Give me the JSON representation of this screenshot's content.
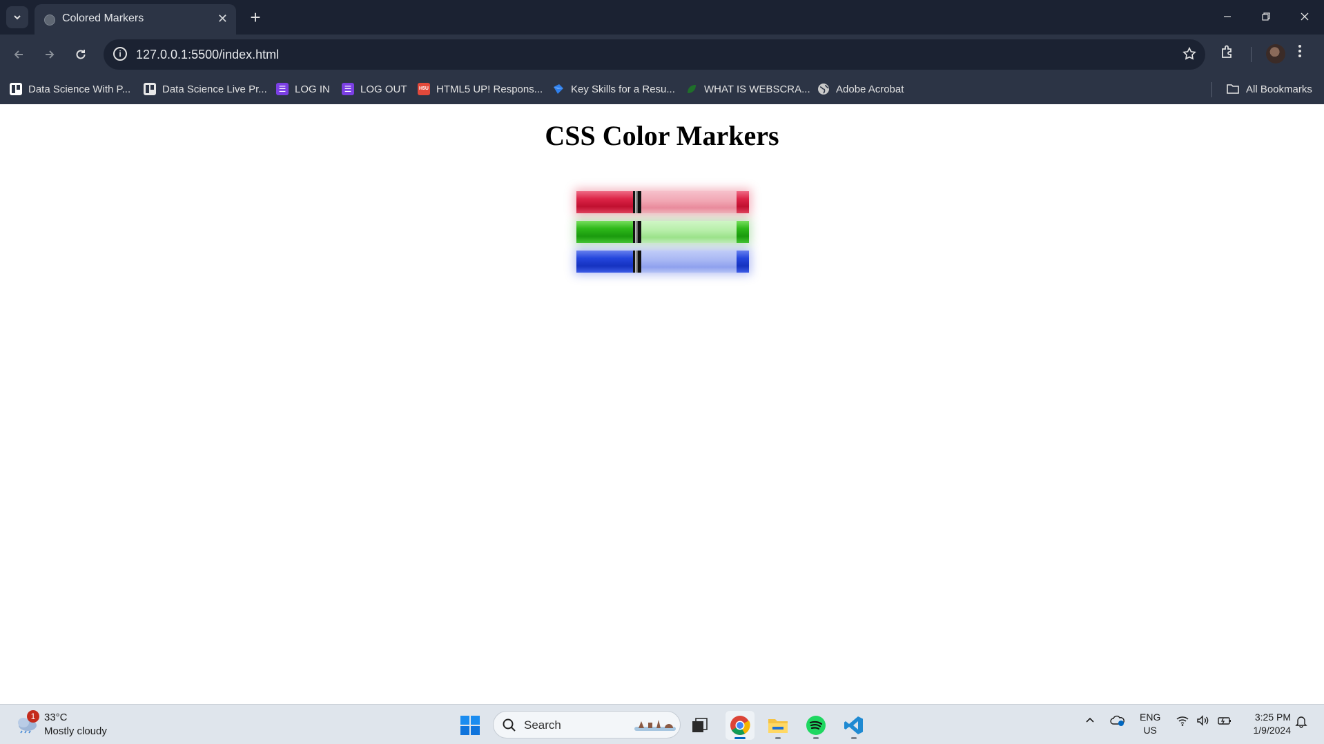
{
  "browser": {
    "tab": {
      "title": "Colored Markers",
      "close_glyph": "✕"
    },
    "new_tab_glyph": "+",
    "address": {
      "url": "127.0.0.1:5500/index.html"
    },
    "bookmarks": [
      {
        "label": "Data Science With P...",
        "icon": "trello-icon",
        "color": "#ffffff"
      },
      {
        "label": "Data Science Live Pr...",
        "icon": "trello-icon",
        "color": "#e8e8e8"
      },
      {
        "label": "LOG IN",
        "icon": "list-icon",
        "color": "#7b3fe4"
      },
      {
        "label": "LOG OUT",
        "icon": "list-icon",
        "color": "#7b3fe4"
      },
      {
        "label": "HTML5 UP! Respons...",
        "icon": "html5up-icon",
        "color": "#e2493b"
      },
      {
        "label": "Key Skills for a Resu...",
        "icon": "diamond-icon",
        "color": "#2f80ed"
      },
      {
        "label": "WHAT IS WEBSCRA...",
        "icon": "leaf-icon",
        "color": "#1f6f2a"
      },
      {
        "label": "Adobe Acrobat",
        "icon": "globe-icon",
        "color": "#c9c9c9"
      }
    ],
    "all_bookmarks_label": "All Bookmarks"
  },
  "page": {
    "heading": "CSS Color Markers",
    "markers": [
      {
        "name": "red",
        "color": "#dc2447"
      },
      {
        "name": "green",
        "color": "#2eb81a"
      },
      {
        "name": "blue",
        "color": "#2446dc"
      }
    ]
  },
  "taskbar": {
    "weather": {
      "badge": "1",
      "temp": "33°C",
      "condition": "Mostly cloudy"
    },
    "search_placeholder": "Search",
    "apps": [
      "task-view",
      "chrome",
      "file-explorer",
      "spotify",
      "vscode"
    ],
    "tray": {
      "lang": "ENG",
      "region": "US",
      "time": "3:25 PM",
      "date": "1/9/2024"
    }
  }
}
